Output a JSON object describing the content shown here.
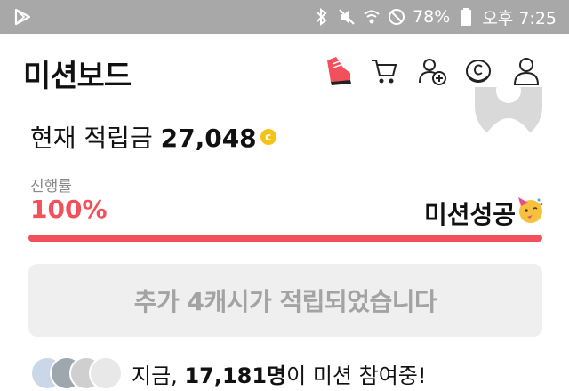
{
  "status_bar": {
    "battery": "78%",
    "time": "오후 7:25",
    "icons": [
      "play-store-icon",
      "bluetooth-icon",
      "mute-icon",
      "wifi-icon",
      "do-not-disturb-icon",
      "battery-icon"
    ]
  },
  "header": {
    "title": "미션보드",
    "icons": [
      "sneaker-icon",
      "cart-icon",
      "add-friend-icon",
      "cash-coin-icon",
      "profile-icon"
    ]
  },
  "points": {
    "label": "현재 적립금",
    "value": "27,048",
    "coin_symbol": "c"
  },
  "progress": {
    "label": "진행률",
    "percent_text": "100%",
    "fraction": 1.0,
    "status": "미션성공",
    "emoji": "party-face-icon",
    "accent": "#f2505a"
  },
  "message": {
    "text": "추가 4캐시가 적립되었습니다"
  },
  "participants": {
    "prefix": "지금,",
    "count": "17,181명",
    "suffix": "이 미션 참여중!"
  }
}
